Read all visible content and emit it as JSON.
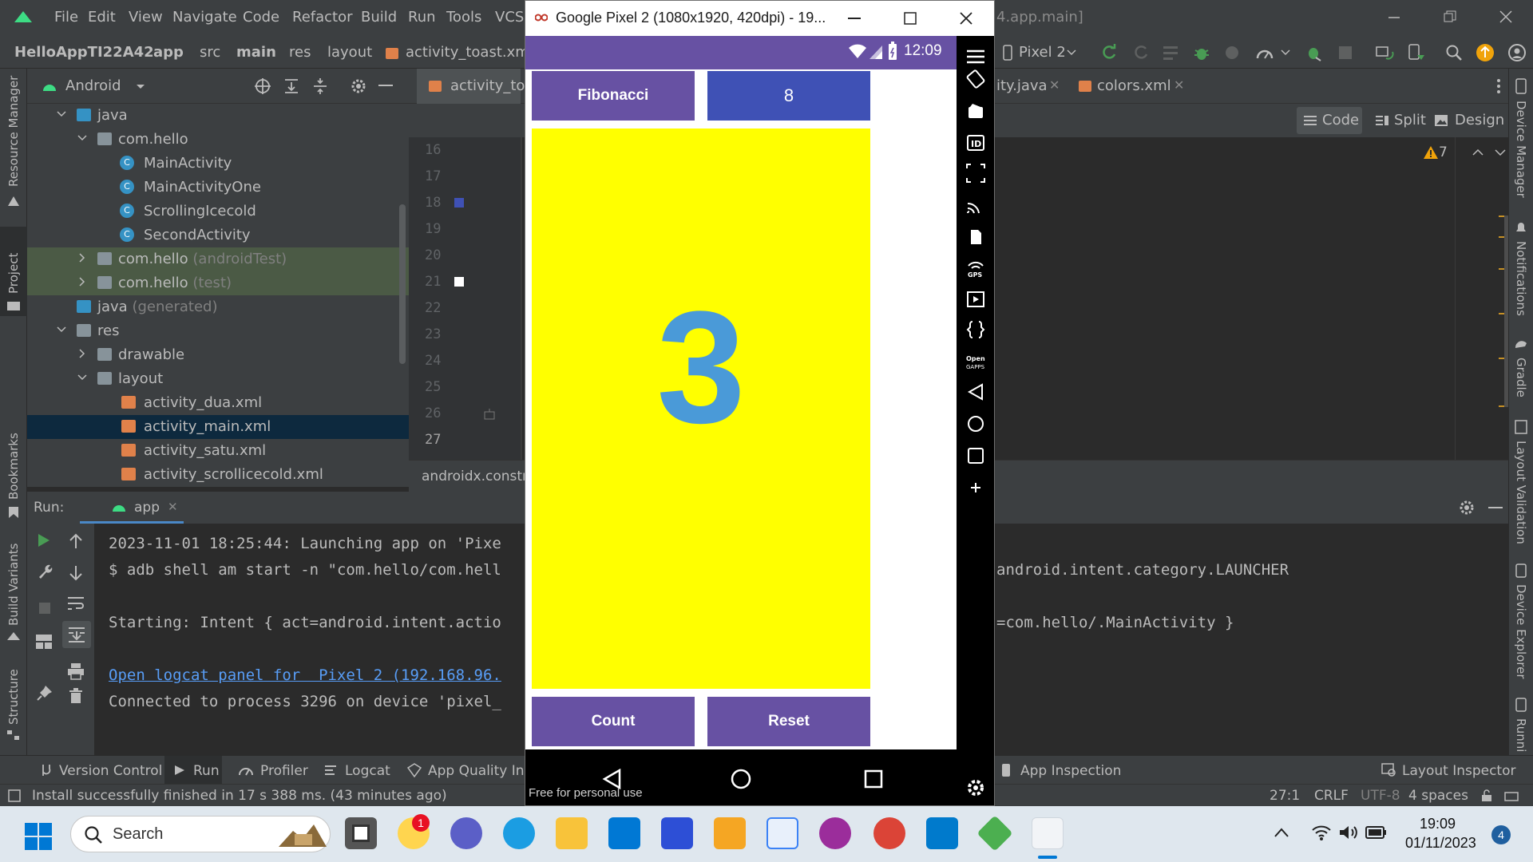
{
  "ide": {
    "menu": [
      "File",
      "Edit",
      "View",
      "Navigate",
      "Code",
      "Refactor",
      "Build",
      "Run",
      "Tools",
      "VCS"
    ],
    "window_title_fragment": "4.app.main]",
    "breadcrumbs": [
      "HelloAppTI22A42",
      "app",
      "src",
      "main",
      "res",
      "layout",
      "activity_toast.xml"
    ],
    "device_selector": "Pixel 2",
    "project_view": "Android",
    "tree": [
      {
        "label": "java",
        "dim": ""
      },
      {
        "label": "com.hello",
        "dim": ""
      },
      {
        "label": "MainActivity",
        "dim": ""
      },
      {
        "label": "MainActivityOne",
        "dim": ""
      },
      {
        "label": "ScrollingIcecold",
        "dim": ""
      },
      {
        "label": "SecondActivity",
        "dim": ""
      },
      {
        "label": "com.hello",
        "dim": "(androidTest)"
      },
      {
        "label": "com.hello",
        "dim": "(test)"
      },
      {
        "label": "java",
        "dim": "(generated)"
      },
      {
        "label": "res",
        "dim": ""
      },
      {
        "label": "drawable",
        "dim": ""
      },
      {
        "label": "layout",
        "dim": ""
      },
      {
        "label": "activity_dua.xml",
        "dim": ""
      },
      {
        "label": "activity_main.xml",
        "dim": ""
      },
      {
        "label": "activity_satu.xml",
        "dim": ""
      },
      {
        "label": "activity_scrollicecold.xml",
        "dim": ""
      }
    ],
    "editor_tabs": [
      "activity_toast",
      "ity.java",
      "colors.xml"
    ],
    "view_modes": [
      "Code",
      "Split",
      "Design"
    ],
    "warning_count": "7",
    "line_numbers": [
      "16",
      "17",
      "18",
      "19",
      "20",
      "21",
      "22",
      "23",
      "24",
      "25",
      "26",
      "27"
    ],
    "editor_breadcrumb": "androidx.constra",
    "run": {
      "label": "Run:",
      "config": "app",
      "lines": [
        {
          "text": "2023-11-01 18:25:44: Launching app on 'Pixe",
          "tail": ""
        },
        {
          "text": "$ adb shell am start -n \"com.hello/com.hell",
          "tail": "android.intent.category.LAUNCHER"
        },
        {
          "text": "Starting: Intent { act=android.intent.actio",
          "tail": "=com.hello/.MainActivity }"
        },
        {
          "text": "Open logcat panel for  Pixel 2 (192.168.96.",
          "tail": ""
        },
        {
          "text": "Connected to process 3296 on device 'pixel_",
          "tail": ""
        }
      ]
    },
    "tool_windows": [
      "Version Control",
      "Run",
      "Profiler",
      "Logcat",
      "App Quality Insig",
      "App Inspection",
      "Layout Inspector"
    ],
    "left_strip": [
      "Resource Manager",
      "Project",
      "Bookmarks",
      "Build Variants",
      "Structure"
    ],
    "right_strip": [
      "Device Manager",
      "Notifications",
      "Gradle",
      "Layout Validation",
      "Device Explorer",
      "Runni"
    ],
    "status_message": "Install successfully finished in 17 s 388 ms. (43 minutes ago)",
    "status_right": {
      "position": "27:1",
      "line_sep": "CRLF",
      "encoding": "UTF-8",
      "indent": "4 spaces"
    }
  },
  "emulator": {
    "title": "Google Pixel 2 (1080x1920, 420dpi) - 19...",
    "clock": "12:09",
    "watermark": "Free for personal use",
    "app": {
      "fibonacci_label": "Fibonacci",
      "fib_value": "8",
      "count_value": "3",
      "count_label": "Count",
      "reset_label": "Reset"
    },
    "colors": {
      "purple": "#6751a3",
      "indigo": "#3f51b5",
      "yellow": "#ffff00",
      "number": "#4a9ad8"
    }
  },
  "taskbar": {
    "search_placeholder": "Search",
    "time": "19:09",
    "date": "01/11/2023",
    "notification_count": "4",
    "badge_count": "1"
  }
}
